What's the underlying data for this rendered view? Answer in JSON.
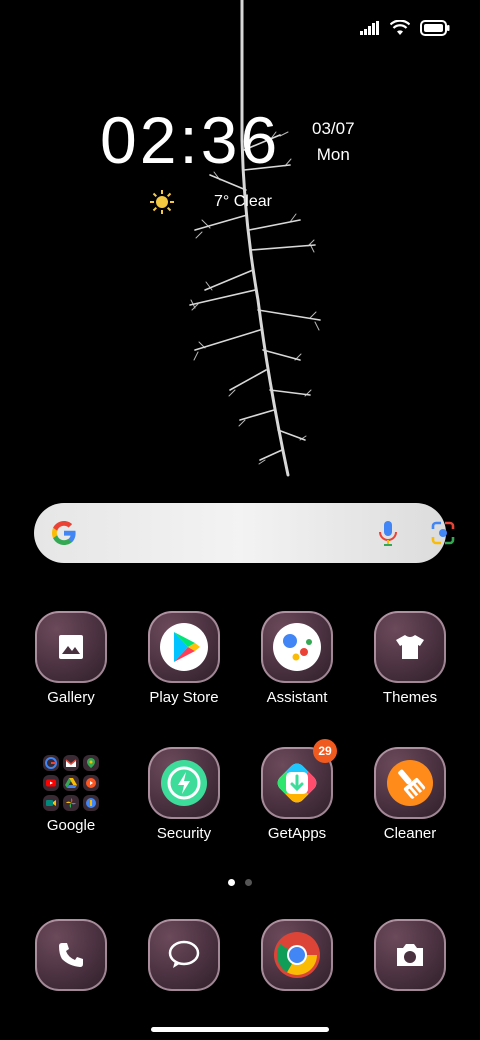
{
  "status": {
    "signal_icon": "signal-icon",
    "wifi_icon": "wifi-icon",
    "battery_icon": "battery-icon"
  },
  "clock": {
    "time": "02:36",
    "date": "03/07",
    "day": "Mon"
  },
  "weather": {
    "icon": "sun-icon",
    "text": "7° Clear"
  },
  "search": {
    "logo": "google-logo-icon",
    "mic": "mic-icon",
    "lens": "lens-icon"
  },
  "apps_row1": [
    {
      "label": "Gallery",
      "icon": "gallery-icon"
    },
    {
      "label": "Play Store",
      "icon": "play-store-icon"
    },
    {
      "label": "Assistant",
      "icon": "assistant-icon"
    },
    {
      "label": "Themes",
      "icon": "themes-icon"
    }
  ],
  "apps_row2": [
    {
      "label": "Google",
      "icon": "folder-icon"
    },
    {
      "label": "Security",
      "icon": "security-icon"
    },
    {
      "label": "GetApps",
      "icon": "getapps-icon",
      "badge": "29"
    },
    {
      "label": "Cleaner",
      "icon": "cleaner-icon"
    }
  ],
  "dock": [
    {
      "icon": "phone-icon"
    },
    {
      "icon": "messages-icon"
    },
    {
      "icon": "chrome-icon"
    },
    {
      "icon": "camera-icon"
    }
  ],
  "pages": {
    "count": 2,
    "active": 1
  },
  "colors": {
    "tile": "#4a3140",
    "badge": "#f05a1e",
    "background": "#000000"
  }
}
